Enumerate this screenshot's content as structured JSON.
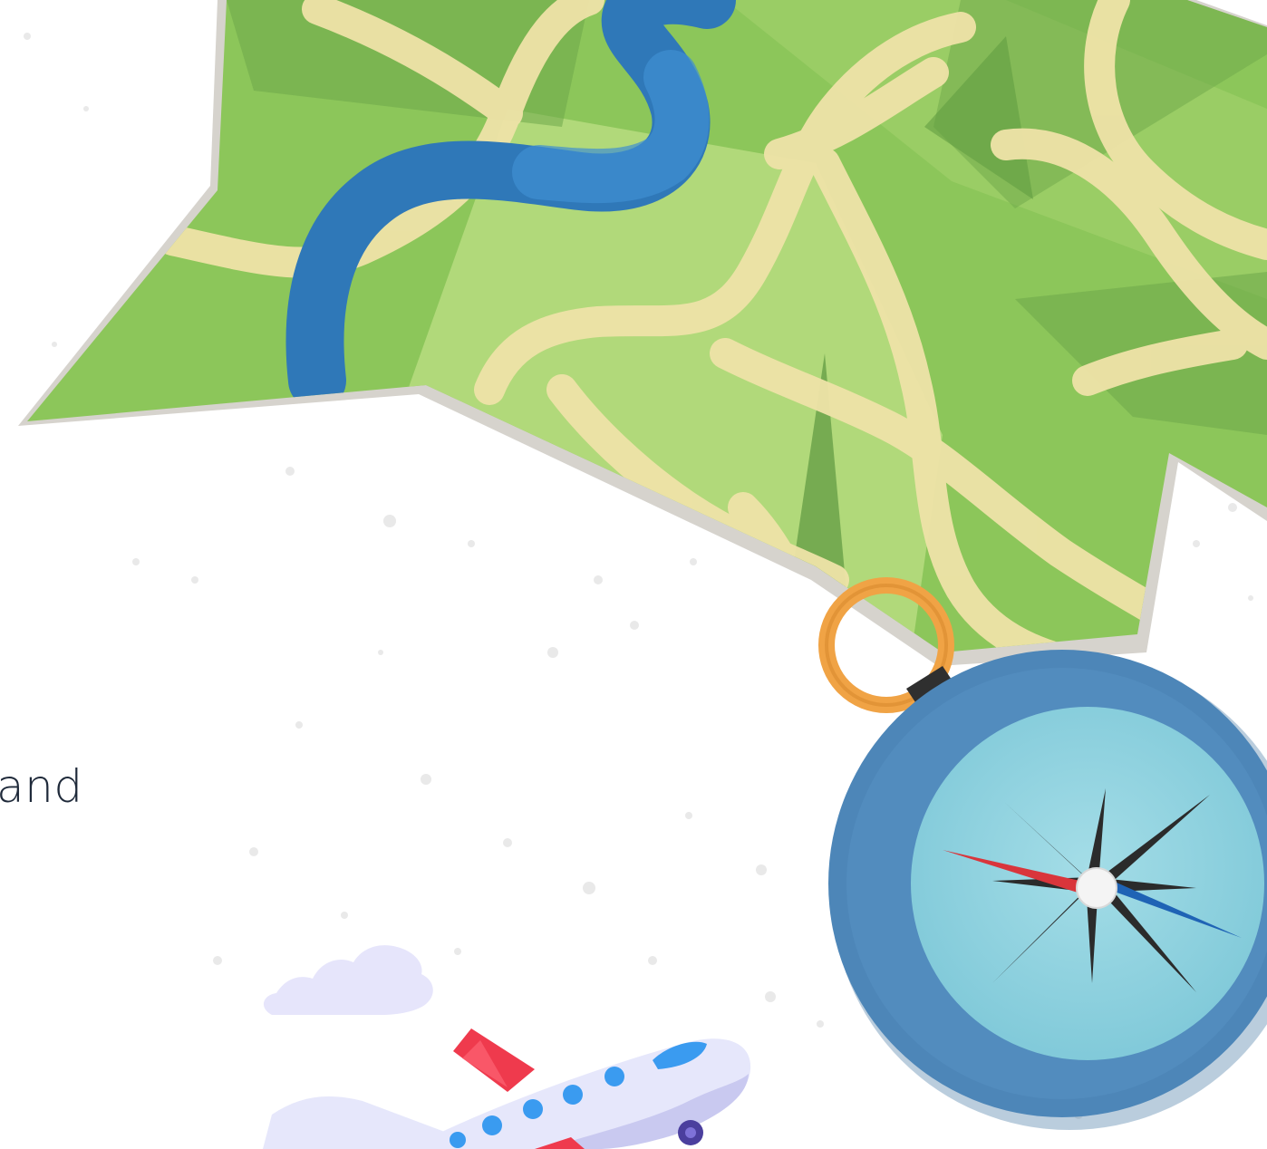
{
  "caption": {
    "text": "and"
  },
  "illustration": {
    "map": {
      "name": "folded-map",
      "colors": {
        "land": "#8cc65a",
        "land_light": "#b7dc80",
        "river": "#2f78b8",
        "road": "#efe3a8",
        "border": "#d6d3cd"
      }
    },
    "compass": {
      "name": "compass",
      "colors": {
        "rim": "#4d86b8",
        "face": "#8fd3e0",
        "ring": "#f0a345",
        "north_needle": "#d9353b",
        "south_needle": "#1f63b5"
      }
    },
    "airplane": {
      "name": "airplane",
      "colors": {
        "body": "#e6e7fb",
        "tail": "#ef3a4d",
        "window": "#3a9bf0"
      }
    },
    "cloud": {
      "name": "cloud",
      "colors": {
        "fill": "#e6e5fb"
      }
    }
  }
}
